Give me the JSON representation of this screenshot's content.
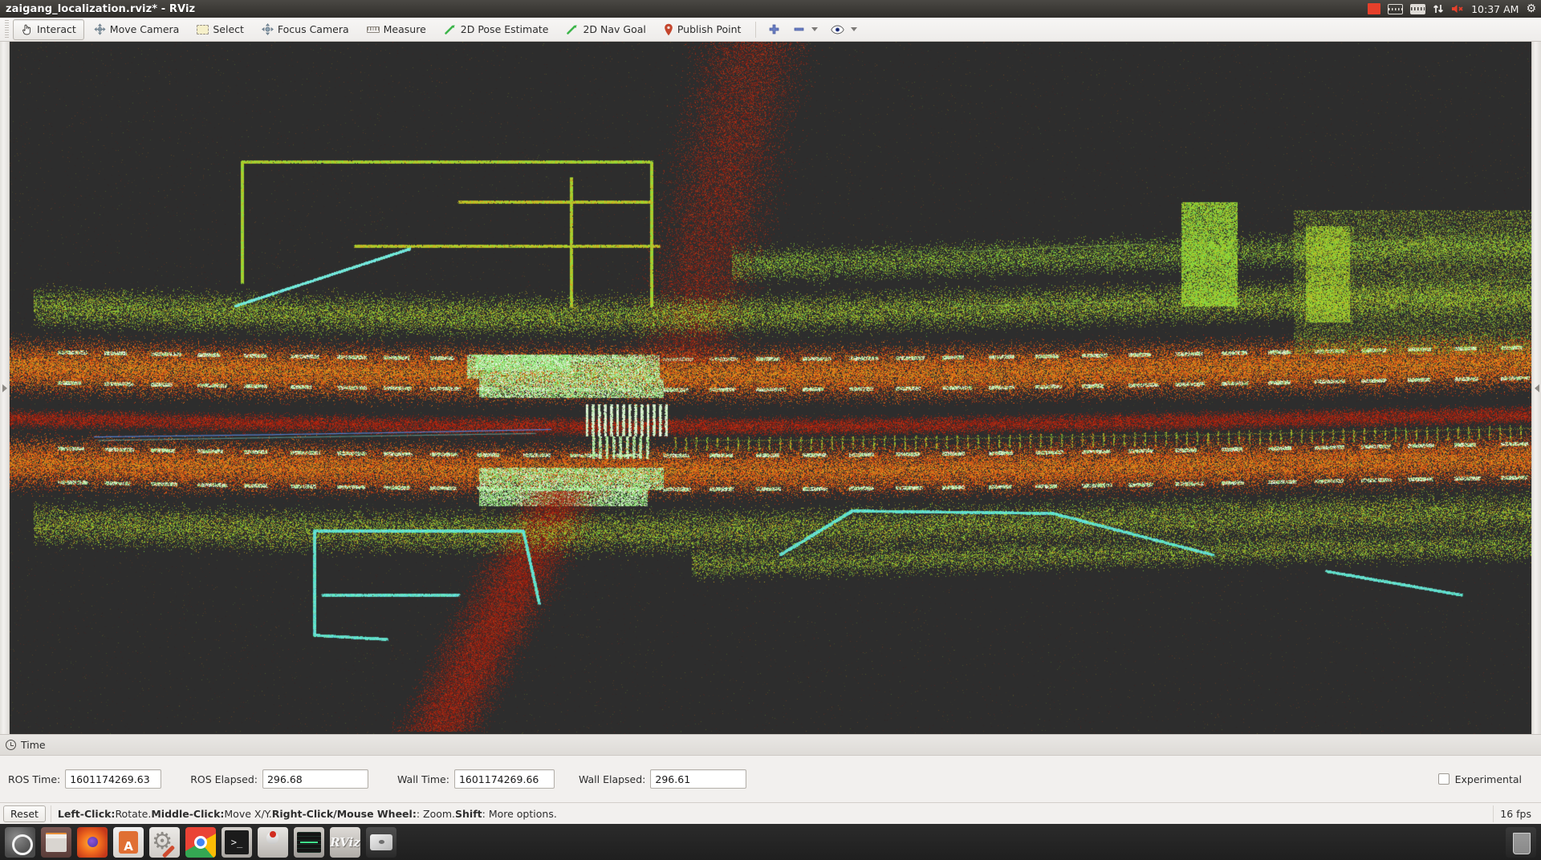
{
  "window": {
    "title": "zaigang_localization.rviz* - RViz"
  },
  "system_tray": {
    "icons": [
      "recording-indicator-icon",
      "keyboard-icon",
      "keyboard-layout-icon",
      "network-icon",
      "volume-muted-icon"
    ],
    "clock": "10:37 AM",
    "gear": "⚙"
  },
  "toolbar": {
    "tools": [
      {
        "label": "Interact",
        "icon": "hand-cursor-icon",
        "active": true
      },
      {
        "label": "Move Camera",
        "icon": "move-camera-icon",
        "active": false
      },
      {
        "label": "Select",
        "icon": "select-box-icon",
        "active": false
      },
      {
        "label": "Focus Camera",
        "icon": "focus-camera-icon",
        "active": false
      },
      {
        "label": "Measure",
        "icon": "ruler-icon",
        "active": false
      },
      {
        "label": "2D Pose Estimate",
        "icon": "green-arrow-icon",
        "active": false
      },
      {
        "label": "2D Nav Goal",
        "icon": "green-arrow-icon",
        "active": false
      },
      {
        "label": "Publish Point",
        "icon": "map-pin-icon",
        "active": false
      }
    ],
    "extra_icons": [
      {
        "name": "add-tool-icon",
        "glyph": "+"
      },
      {
        "name": "remove-tool-icon",
        "glyph": "−",
        "has_caret": true
      },
      {
        "name": "visibility-eye-icon",
        "glyph": "eye",
        "has_caret": true
      }
    ]
  },
  "viewport": {
    "background_color": "#2d2d2d",
    "left_panel_handle": "expand-left-panel-handle",
    "right_panel_handle": "expand-right-panel-handle",
    "content_description": "LiDAR point cloud map of a road intersection, intensity colored"
  },
  "time_panel": {
    "header": "Time",
    "fields": [
      {
        "label": "ROS Time:",
        "value": "1601174269.63"
      },
      {
        "label": "ROS Elapsed:",
        "value": "296.68"
      },
      {
        "label": "Wall Time:",
        "value": "1601174269.66"
      },
      {
        "label": "Wall Elapsed:",
        "value": "296.61"
      }
    ],
    "experimental": {
      "label": "Experimental",
      "checked": false
    }
  },
  "status_bar": {
    "reset_label": "Reset",
    "hint_parts": [
      {
        "text": "Left-Click:",
        "bold": true
      },
      {
        "text": " Rotate. ",
        "bold": false
      },
      {
        "text": "Middle-Click:",
        "bold": true
      },
      {
        "text": " Move X/Y. ",
        "bold": false
      },
      {
        "text": "Right-Click/Mouse Wheel:",
        "bold": true
      },
      {
        "text": ": Zoom. ",
        "bold": false
      },
      {
        "text": "Shift",
        "bold": true
      },
      {
        "text": ": More options.",
        "bold": false
      }
    ],
    "fps": "16 fps"
  },
  "dock": {
    "items": [
      {
        "name": "ubuntu-dash-icon",
        "class": "dk-ubuntu",
        "label": ""
      },
      {
        "name": "files-icon",
        "class": "dk-files",
        "label": ""
      },
      {
        "name": "firefox-icon",
        "class": "dk-firefox",
        "label": ""
      },
      {
        "name": "software-center-icon",
        "class": "dk-software",
        "label": ""
      },
      {
        "name": "system-tools-icon",
        "class": "dk-tools",
        "label": ""
      },
      {
        "name": "chrome-icon",
        "class": "dk-chrome",
        "label": ""
      },
      {
        "name": "terminal-icon",
        "class": "dk-terminal",
        "label": ""
      },
      {
        "name": "java-icon",
        "class": "dk-java",
        "label": ""
      },
      {
        "name": "system-monitor-icon",
        "class": "dk-monitor",
        "label": ""
      },
      {
        "name": "rviz-icon",
        "class": "dk-rviz",
        "label": "RViz"
      },
      {
        "name": "disc-drive-icon",
        "class": "dk-disc",
        "label": ""
      }
    ],
    "trash": {
      "name": "trash-icon",
      "label": ""
    }
  },
  "colors": {
    "titlebar": "#3c3a36",
    "toolbar": "#f2f0ee",
    "viewport_bg": "#2d2d2d",
    "accent_green": "#3cb54a",
    "accent_orange": "#e06f33"
  }
}
